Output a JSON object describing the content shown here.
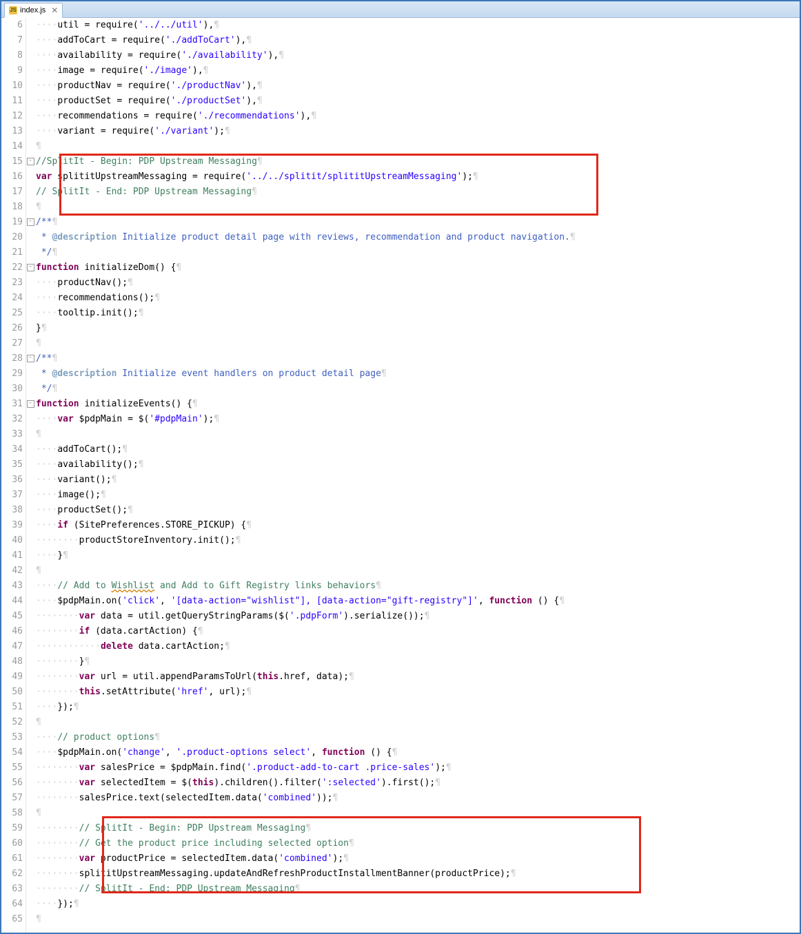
{
  "tab": {
    "icon_label": "JS",
    "title": "index.js",
    "close_glyph": "✕"
  },
  "gutter": {
    "start": 6,
    "end": 65
  },
  "fold": {
    "marks": {
      "15": "-",
      "19": "-",
      "22": "-",
      "28": "-",
      "31": "-"
    }
  },
  "code_lines": [
    {
      "n": 6,
      "seg": [
        [
          "ws",
          "····"
        ],
        [
          "txt",
          "util = require("
        ],
        [
          "str",
          "'../../util'"
        ],
        [
          "txt",
          "),"
        ],
        [
          "ws",
          "¶"
        ]
      ]
    },
    {
      "n": 7,
      "seg": [
        [
          "ws",
          "····"
        ],
        [
          "txt",
          "addToCart = require("
        ],
        [
          "str",
          "'./addToCart'"
        ],
        [
          "txt",
          "),"
        ],
        [
          "ws",
          "¶"
        ]
      ]
    },
    {
      "n": 8,
      "seg": [
        [
          "ws",
          "····"
        ],
        [
          "txt",
          "availability = require("
        ],
        [
          "str",
          "'./availability'"
        ],
        [
          "txt",
          "),"
        ],
        [
          "ws",
          "¶"
        ]
      ]
    },
    {
      "n": 9,
      "seg": [
        [
          "ws",
          "····"
        ],
        [
          "txt",
          "image = require("
        ],
        [
          "str",
          "'./image'"
        ],
        [
          "txt",
          "),"
        ],
        [
          "ws",
          "¶"
        ]
      ]
    },
    {
      "n": 10,
      "seg": [
        [
          "ws",
          "····"
        ],
        [
          "txt",
          "productNav = require("
        ],
        [
          "str",
          "'./productNav'"
        ],
        [
          "txt",
          "),"
        ],
        [
          "ws",
          "¶"
        ]
      ]
    },
    {
      "n": 11,
      "seg": [
        [
          "ws",
          "····"
        ],
        [
          "txt",
          "productSet = require("
        ],
        [
          "str",
          "'./productSet'"
        ],
        [
          "txt",
          "),"
        ],
        [
          "ws",
          "¶"
        ]
      ]
    },
    {
      "n": 12,
      "seg": [
        [
          "ws",
          "····"
        ],
        [
          "txt",
          "recommendations = require("
        ],
        [
          "str",
          "'./recommendations'"
        ],
        [
          "txt",
          "),"
        ],
        [
          "ws",
          "¶"
        ]
      ]
    },
    {
      "n": 13,
      "seg": [
        [
          "ws",
          "····"
        ],
        [
          "txt",
          "variant = require("
        ],
        [
          "str",
          "'./variant'"
        ],
        [
          "txt",
          ");"
        ],
        [
          "ws",
          "¶"
        ]
      ]
    },
    {
      "n": 14,
      "seg": [
        [
          "ws",
          "¶"
        ]
      ]
    },
    {
      "n": 15,
      "seg": [
        [
          "com",
          "//SplitIt - Begin: PDP Upstream Messaging"
        ],
        [
          "ws",
          "¶"
        ]
      ]
    },
    {
      "n": 16,
      "seg": [
        [
          "kw",
          "var"
        ],
        [
          "txt",
          " splititUpstreamMessaging = require("
        ],
        [
          "str",
          "'../../splitit/splititUpstreamMessaging'"
        ],
        [
          "txt",
          ");"
        ],
        [
          "ws",
          "¶"
        ]
      ]
    },
    {
      "n": 17,
      "seg": [
        [
          "com",
          "// SplitIt - End: PDP Upstream Messaging"
        ],
        [
          "ws",
          "¶"
        ]
      ]
    },
    {
      "n": 18,
      "seg": [
        [
          "ws",
          "¶"
        ]
      ]
    },
    {
      "n": 19,
      "seg": [
        [
          "doc",
          "/**"
        ],
        [
          "ws",
          "¶"
        ]
      ]
    },
    {
      "n": 20,
      "seg": [
        [
          "doc",
          " * "
        ],
        [
          "tag",
          "@description"
        ],
        [
          "doc",
          " Initialize product detail page with reviews, recommendation and product navigation."
        ],
        [
          "ws",
          "¶"
        ]
      ]
    },
    {
      "n": 21,
      "seg": [
        [
          "doc",
          " */"
        ],
        [
          "ws",
          "¶"
        ]
      ]
    },
    {
      "n": 22,
      "seg": [
        [
          "kw",
          "function"
        ],
        [
          "txt",
          " initializeDom() {"
        ],
        [
          "ws",
          "¶"
        ]
      ]
    },
    {
      "n": 23,
      "seg": [
        [
          "ws",
          "····"
        ],
        [
          "txt",
          "productNav();"
        ],
        [
          "ws",
          "¶"
        ]
      ]
    },
    {
      "n": 24,
      "seg": [
        [
          "ws",
          "····"
        ],
        [
          "txt",
          "recommendations();"
        ],
        [
          "ws",
          "¶"
        ]
      ]
    },
    {
      "n": 25,
      "seg": [
        [
          "ws",
          "····"
        ],
        [
          "txt",
          "tooltip.init();"
        ],
        [
          "ws",
          "¶"
        ]
      ]
    },
    {
      "n": 26,
      "seg": [
        [
          "txt",
          "}"
        ],
        [
          "ws",
          "¶"
        ]
      ]
    },
    {
      "n": 27,
      "seg": [
        [
          "ws",
          "¶"
        ]
      ]
    },
    {
      "n": 28,
      "seg": [
        [
          "doc",
          "/**"
        ],
        [
          "ws",
          "¶"
        ]
      ]
    },
    {
      "n": 29,
      "seg": [
        [
          "doc",
          " * "
        ],
        [
          "tag",
          "@description"
        ],
        [
          "doc",
          " Initialize event handlers on product detail page"
        ],
        [
          "ws",
          "¶"
        ]
      ]
    },
    {
      "n": 30,
      "seg": [
        [
          "doc",
          " */"
        ],
        [
          "ws",
          "¶"
        ]
      ]
    },
    {
      "n": 31,
      "seg": [
        [
          "kw",
          "function"
        ],
        [
          "txt",
          " initializeEvents() {"
        ],
        [
          "ws",
          "¶"
        ]
      ]
    },
    {
      "n": 32,
      "seg": [
        [
          "ws",
          "····"
        ],
        [
          "kw",
          "var"
        ],
        [
          "txt",
          " $pdpMain = $("
        ],
        [
          "str",
          "'#pdpMain'"
        ],
        [
          "txt",
          ");"
        ],
        [
          "ws",
          "¶"
        ]
      ]
    },
    {
      "n": 33,
      "seg": [
        [
          "ws",
          "¶"
        ]
      ]
    },
    {
      "n": 34,
      "seg": [
        [
          "ws",
          "····"
        ],
        [
          "txt",
          "addToCart();"
        ],
        [
          "ws",
          "¶"
        ]
      ]
    },
    {
      "n": 35,
      "seg": [
        [
          "ws",
          "····"
        ],
        [
          "txt",
          "availability();"
        ],
        [
          "ws",
          "¶"
        ]
      ]
    },
    {
      "n": 36,
      "seg": [
        [
          "ws",
          "····"
        ],
        [
          "txt",
          "variant();"
        ],
        [
          "ws",
          "¶"
        ]
      ]
    },
    {
      "n": 37,
      "seg": [
        [
          "ws",
          "····"
        ],
        [
          "txt",
          "image();"
        ],
        [
          "ws",
          "¶"
        ]
      ]
    },
    {
      "n": 38,
      "seg": [
        [
          "ws",
          "····"
        ],
        [
          "txt",
          "productSet();"
        ],
        [
          "ws",
          "¶"
        ]
      ]
    },
    {
      "n": 39,
      "seg": [
        [
          "ws",
          "····"
        ],
        [
          "kw",
          "if"
        ],
        [
          "txt",
          " (SitePreferences.STORE_PICKUP) {"
        ],
        [
          "ws",
          "¶"
        ]
      ]
    },
    {
      "n": 40,
      "seg": [
        [
          "ws",
          "········"
        ],
        [
          "txt",
          "productStoreInventory.init();"
        ],
        [
          "ws",
          "¶"
        ]
      ]
    },
    {
      "n": 41,
      "seg": [
        [
          "ws",
          "····"
        ],
        [
          "txt",
          "}"
        ],
        [
          "ws",
          "¶"
        ]
      ]
    },
    {
      "n": 42,
      "seg": [
        [
          "ws",
          "¶"
        ]
      ]
    },
    {
      "n": 43,
      "seg": [
        [
          "ws",
          "····"
        ],
        [
          "com",
          "// Add to "
        ],
        [
          "wavycom",
          "Wishlist"
        ],
        [
          "com",
          " and Add to Gift Registry links behaviors"
        ],
        [
          "ws",
          "¶"
        ]
      ]
    },
    {
      "n": 44,
      "seg": [
        [
          "ws",
          "····"
        ],
        [
          "txt",
          "$pdpMain.on("
        ],
        [
          "str",
          "'click'"
        ],
        [
          "txt",
          ", "
        ],
        [
          "str",
          "'[data-action=\"wishlist\"], [data-action=\"gift-registry\"]'"
        ],
        [
          "txt",
          ", "
        ],
        [
          "kw",
          "function"
        ],
        [
          "txt",
          " () {"
        ],
        [
          "ws",
          "¶"
        ]
      ]
    },
    {
      "n": 45,
      "seg": [
        [
          "ws",
          "········"
        ],
        [
          "kw",
          "var"
        ],
        [
          "txt",
          " data = util.getQueryStringParams($("
        ],
        [
          "str",
          "'.pdpForm'"
        ],
        [
          "txt",
          ").serialize());"
        ],
        [
          "ws",
          "¶"
        ]
      ]
    },
    {
      "n": 46,
      "seg": [
        [
          "ws",
          "········"
        ],
        [
          "kw",
          "if"
        ],
        [
          "txt",
          " (data.cartAction) {"
        ],
        [
          "ws",
          "¶"
        ]
      ]
    },
    {
      "n": 47,
      "seg": [
        [
          "ws",
          "············"
        ],
        [
          "kw",
          "delete"
        ],
        [
          "txt",
          " data.cartAction;"
        ],
        [
          "ws",
          "¶"
        ]
      ]
    },
    {
      "n": 48,
      "seg": [
        [
          "ws",
          "········"
        ],
        [
          "txt",
          "}"
        ],
        [
          "ws",
          "¶"
        ]
      ]
    },
    {
      "n": 49,
      "seg": [
        [
          "ws",
          "········"
        ],
        [
          "kw",
          "var"
        ],
        [
          "txt",
          " url = util.appendParamsToUrl("
        ],
        [
          "kw",
          "this"
        ],
        [
          "txt",
          ".href, data);"
        ],
        [
          "ws",
          "¶"
        ]
      ]
    },
    {
      "n": 50,
      "seg": [
        [
          "ws",
          "········"
        ],
        [
          "kw",
          "this"
        ],
        [
          "txt",
          ".setAttribute("
        ],
        [
          "str",
          "'href'"
        ],
        [
          "txt",
          ", url);"
        ],
        [
          "ws",
          "¶"
        ]
      ]
    },
    {
      "n": 51,
      "seg": [
        [
          "ws",
          "····"
        ],
        [
          "txt",
          "});"
        ],
        [
          "ws",
          "¶"
        ]
      ]
    },
    {
      "n": 52,
      "seg": [
        [
          "ws",
          "¶"
        ]
      ]
    },
    {
      "n": 53,
      "seg": [
        [
          "ws",
          "····"
        ],
        [
          "com",
          "// product options"
        ],
        [
          "ws",
          "¶"
        ]
      ]
    },
    {
      "n": 54,
      "seg": [
        [
          "ws",
          "····"
        ],
        [
          "txt",
          "$pdpMain.on("
        ],
        [
          "str",
          "'change'"
        ],
        [
          "txt",
          ", "
        ],
        [
          "str",
          "'.product-options select'"
        ],
        [
          "txt",
          ", "
        ],
        [
          "kw",
          "function"
        ],
        [
          "txt",
          " () {"
        ],
        [
          "ws",
          "¶"
        ]
      ]
    },
    {
      "n": 55,
      "seg": [
        [
          "ws",
          "········"
        ],
        [
          "kw",
          "var"
        ],
        [
          "txt",
          " salesPrice = $pdpMain.find("
        ],
        [
          "str",
          "'.product-add-to-cart .price-sales'"
        ],
        [
          "txt",
          ");"
        ],
        [
          "ws",
          "¶"
        ]
      ]
    },
    {
      "n": 56,
      "seg": [
        [
          "ws",
          "········"
        ],
        [
          "kw",
          "var"
        ],
        [
          "txt",
          " selectedItem = $("
        ],
        [
          "kw",
          "this"
        ],
        [
          "txt",
          ").children().filter("
        ],
        [
          "str",
          "':selected'"
        ],
        [
          "txt",
          ").first();"
        ],
        [
          "ws",
          "¶"
        ]
      ]
    },
    {
      "n": 57,
      "seg": [
        [
          "ws",
          "········"
        ],
        [
          "txt",
          "salesPrice.text(selectedItem.data("
        ],
        [
          "str",
          "'combined'"
        ],
        [
          "txt",
          "));"
        ],
        [
          "ws",
          "¶"
        ]
      ]
    },
    {
      "n": 58,
      "seg": [
        [
          "ws",
          "¶"
        ]
      ]
    },
    {
      "n": 59,
      "seg": [
        [
          "ws",
          "········"
        ],
        [
          "com",
          "// SplitIt - Begin: PDP Upstream Messaging"
        ],
        [
          "ws",
          "¶"
        ]
      ]
    },
    {
      "n": 60,
      "seg": [
        [
          "ws",
          "········"
        ],
        [
          "com",
          "// Get the product price including selected option"
        ],
        [
          "ws",
          "¶"
        ]
      ]
    },
    {
      "n": 61,
      "seg": [
        [
          "ws",
          "········"
        ],
        [
          "kw",
          "var"
        ],
        [
          "txt",
          " productPrice = selectedItem.data("
        ],
        [
          "str",
          "'combined'"
        ],
        [
          "txt",
          ");"
        ],
        [
          "ws",
          "¶"
        ]
      ]
    },
    {
      "n": 62,
      "seg": [
        [
          "ws",
          "········"
        ],
        [
          "txt",
          "splititUpstreamMessaging.updateAndRefreshProductInstallmentBanner(productPrice);"
        ],
        [
          "ws",
          "¶"
        ]
      ]
    },
    {
      "n": 63,
      "seg": [
        [
          "ws",
          "········"
        ],
        [
          "com",
          "// SplitIt - End: PDP Upstream Messaging"
        ],
        [
          "ws",
          "¶"
        ]
      ]
    },
    {
      "n": 64,
      "seg": [
        [
          "ws",
          "····"
        ],
        [
          "txt",
          "});"
        ],
        [
          "ws",
          "¶"
        ]
      ]
    },
    {
      "n": 65,
      "seg": [
        [
          "ws",
          "¶"
        ]
      ]
    }
  ]
}
